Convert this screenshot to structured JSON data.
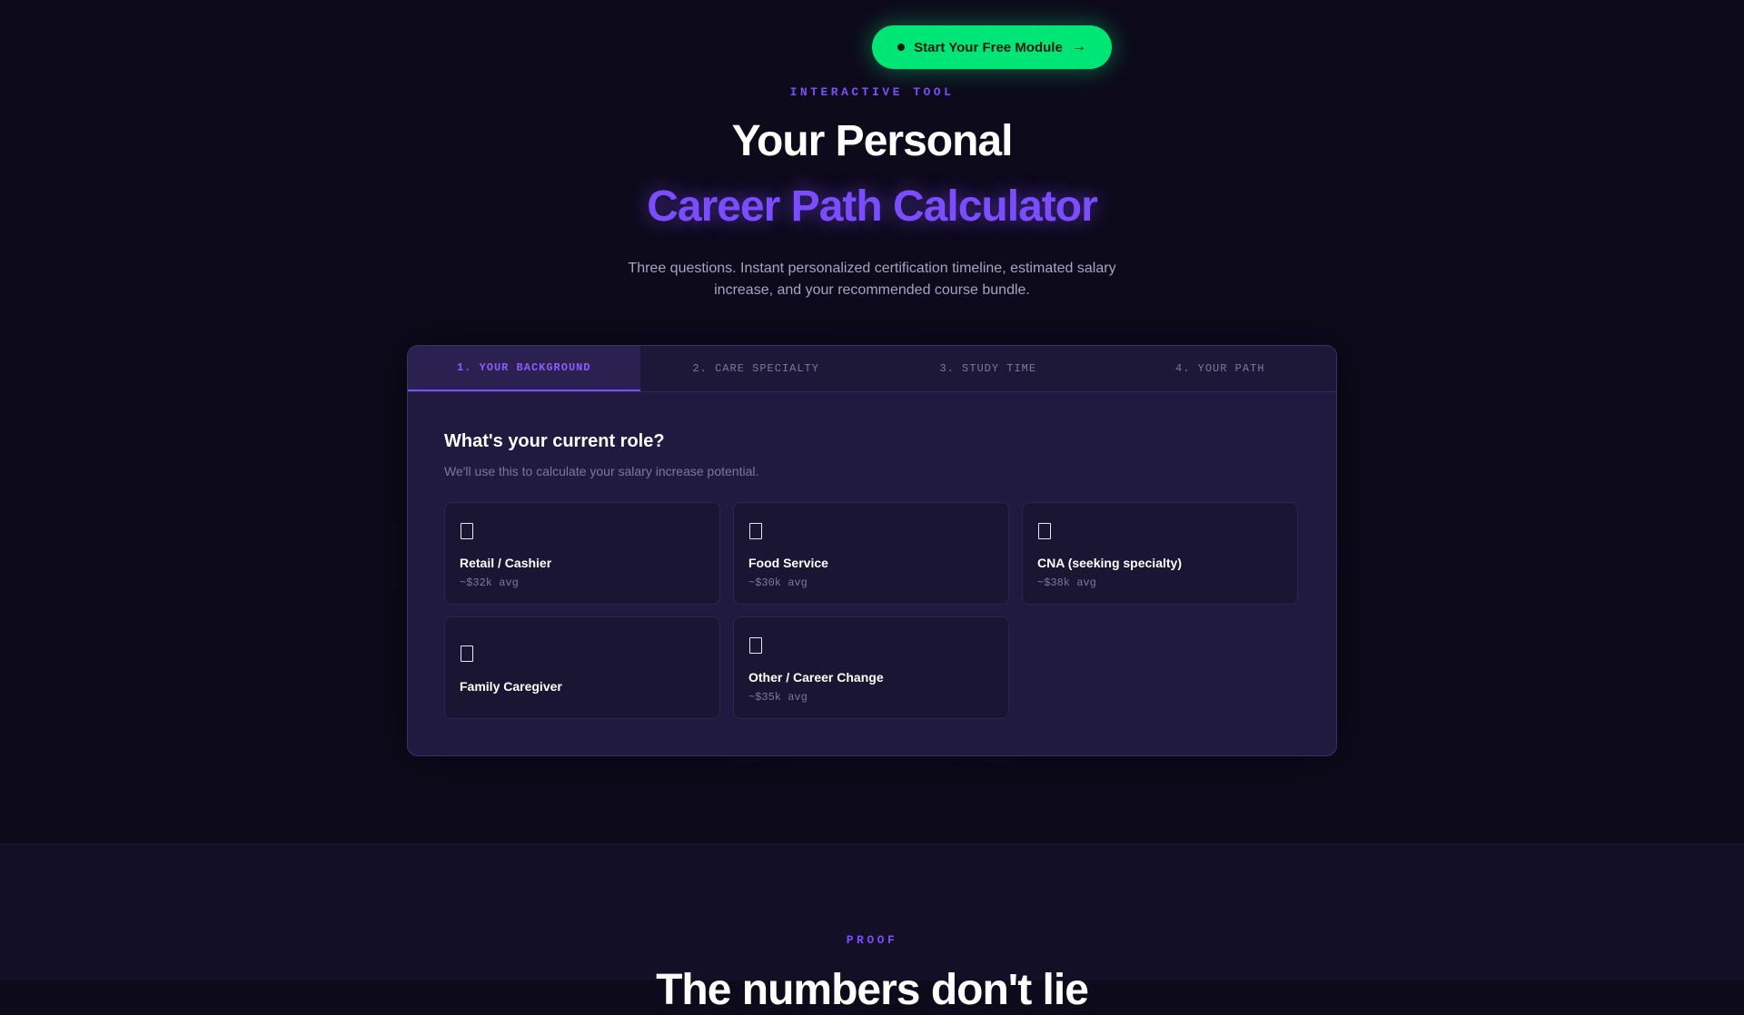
{
  "cta": {
    "label": "Start Your Free Module"
  },
  "hero": {
    "eyebrow": "INTERACTIVE TOOL",
    "title_line1": "Your Personal",
    "title_line2": "Career Path Calculator",
    "subtitle": "Three questions. Instant personalized certification timeline, estimated salary increase, and your recommended course bundle."
  },
  "calculator": {
    "tabs": [
      {
        "label": "1. YOUR BACKGROUND",
        "active": true
      },
      {
        "label": "2. CARE SPECIALTY",
        "active": false
      },
      {
        "label": "3. STUDY TIME",
        "active": false
      },
      {
        "label": "4. YOUR PATH",
        "active": false
      }
    ],
    "question": "What's your current role?",
    "helper": "We'll use this to calculate your salary increase potential.",
    "options": [
      {
        "label": "Retail / Cashier",
        "avg": "~$32k avg",
        "icon": "placeholder-glyph-icon"
      },
      {
        "label": "Food Service",
        "avg": "~$30k avg",
        "icon": "placeholder-glyph-icon"
      },
      {
        "label": "CNA (seeking specialty)",
        "avg": "~$38k avg",
        "icon": "placeholder-glyph-icon"
      },
      {
        "label": "Family Caregiver",
        "avg": "",
        "icon": "placeholder-glyph-icon"
      },
      {
        "label": "Other / Career Change",
        "avg": "~$35k avg",
        "icon": "placeholder-glyph-icon"
      }
    ]
  },
  "proof_section": {
    "eyebrow": "PROOF",
    "title": "The numbers don't lie"
  },
  "colors": {
    "background": "#0d0a1b",
    "accent_purple": "#7c4dff",
    "cta_green": "#00e676",
    "card_background": "#201a40"
  }
}
